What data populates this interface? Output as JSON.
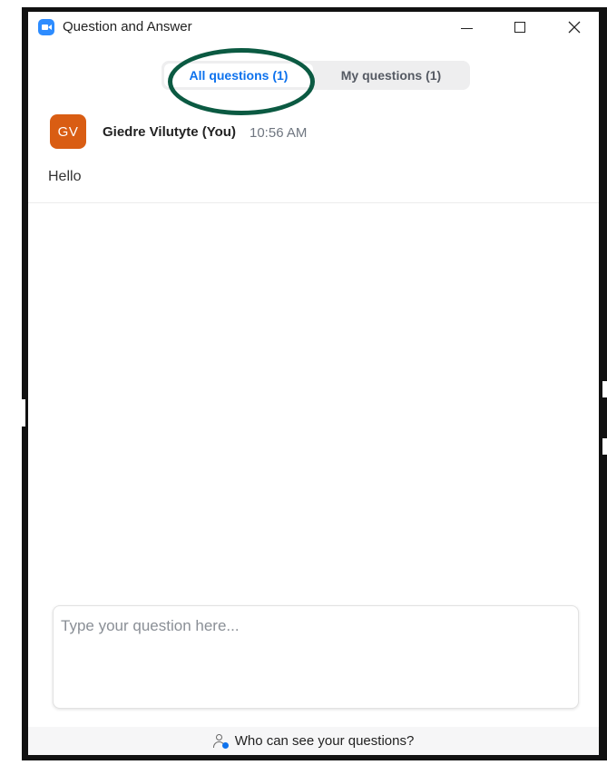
{
  "window": {
    "title": "Question and Answer",
    "icon": "zoom-logo-icon",
    "controls": [
      "minimize-icon",
      "maximize-icon",
      "close-icon"
    ]
  },
  "tabs": [
    {
      "label": "All questions (1)",
      "selected": true
    },
    {
      "label": "My questions (1)",
      "selected": false
    }
  ],
  "question": {
    "avatar_initials": "GV",
    "avatar_color": "#d95d13",
    "author": "Giedre Vilutyte (You)",
    "time": "10:56 AM",
    "text": "Hello"
  },
  "input": {
    "placeholder": "Type your question here...",
    "value": ""
  },
  "footer": {
    "icon": "visibility-person-icon",
    "text": "Who can see your questions?"
  },
  "colors": {
    "accent": "#0e72ed",
    "highlight_ring": "#0b5a42",
    "avatar": "#d95d13"
  }
}
